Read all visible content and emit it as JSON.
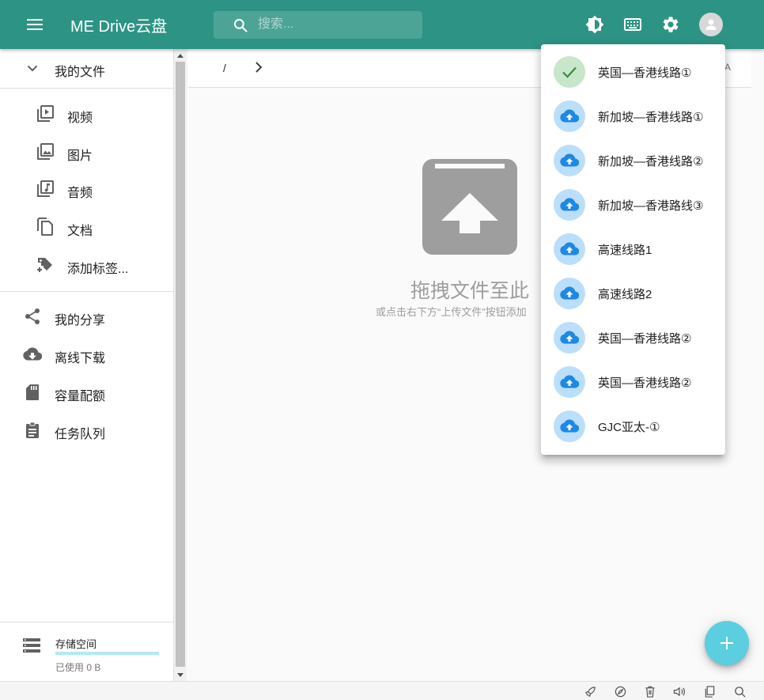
{
  "app": {
    "title": "ME Drive云盘"
  },
  "search": {
    "placeholder": "搜索..."
  },
  "topbar_icons": [
    "menu-icon",
    "search-icon",
    "theme-toggle-icon",
    "keyboard-icon",
    "settings-icon",
    "account-icon"
  ],
  "sidebar": {
    "my_files": "我的文件",
    "categories": [
      {
        "label": "视频",
        "icon": "video-library-icon"
      },
      {
        "label": "图片",
        "icon": "photo-library-icon"
      },
      {
        "label": "音频",
        "icon": "music-library-icon"
      },
      {
        "label": "文档",
        "icon": "file-copy-icon"
      },
      {
        "label": "添加标签...",
        "icon": "add-tag-icon"
      }
    ],
    "links": [
      {
        "label": "我的分享",
        "icon": "share-icon"
      },
      {
        "label": "离线下载",
        "icon": "cloud-download-icon"
      },
      {
        "label": "容量配额",
        "icon": "sd-card-icon"
      },
      {
        "label": "任务队列",
        "icon": "clipboard-icon"
      }
    ],
    "storage": {
      "title": "存储空间",
      "used": "已使用 0 B",
      "fraction": 0.0
    }
  },
  "breadcrumb": {
    "root": "/",
    "sort_glyph": "A"
  },
  "empty_state": {
    "title": "拖拽文件至此",
    "hint": "或点击右下方“上传文件”按钮添加"
  },
  "node_menu": {
    "items": [
      {
        "label": "英国—香港线路①",
        "selected": true
      },
      {
        "label": "新加坡—香港线路①",
        "selected": false
      },
      {
        "label": "新加坡—香港线路②",
        "selected": false
      },
      {
        "label": "新加坡—香港路线③",
        "selected": false
      },
      {
        "label": "高速线路1",
        "selected": false
      },
      {
        "label": "高速线路2",
        "selected": false
      },
      {
        "label": "英国—香港线路②",
        "selected": false
      },
      {
        "label": "英国—香港线路②",
        "selected": false
      },
      {
        "label": "GJC亚太-①",
        "selected": false
      }
    ]
  },
  "fab": {
    "icon": "add-icon"
  },
  "bottom_strip_icons": [
    "rocket-icon",
    "compass-icon",
    "trash-icon",
    "volume-icon",
    "copy-icon",
    "search-icon"
  ],
  "colors": {
    "primary": "#2d9485",
    "accent": "#5bcee0",
    "selected_bg": "#c8e6c9",
    "selected_fg": "#388e3c",
    "cloud_bg": "#bbdefb",
    "cloud_fg": "#1e88e5",
    "icon_grey": "#757575",
    "drop_grey": "#9e9e9e"
  }
}
